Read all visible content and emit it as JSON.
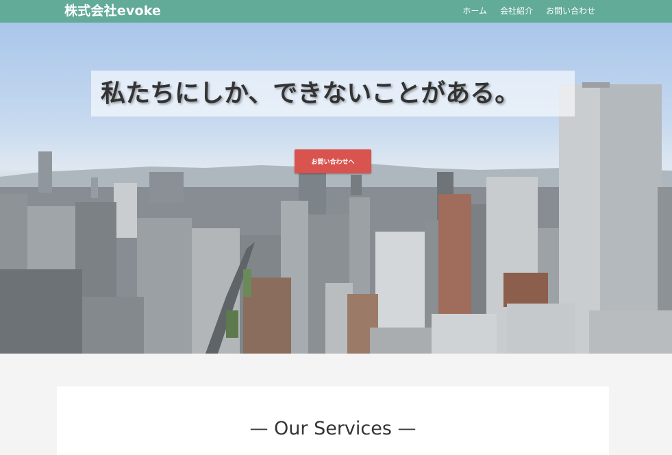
{
  "navbar": {
    "brand": "株式会社evoke",
    "links": [
      "ホーム",
      "会社紹介",
      "お問い合わせ"
    ]
  },
  "hero": {
    "headline": "私たちにしか、できないことがある。",
    "cta_label": "お問い合わせへ"
  },
  "services": {
    "title": "— Our Services —"
  },
  "colors": {
    "navbar": "#62ab98",
    "cta": "#d9534f",
    "page_background": "#f4f4f4"
  }
}
